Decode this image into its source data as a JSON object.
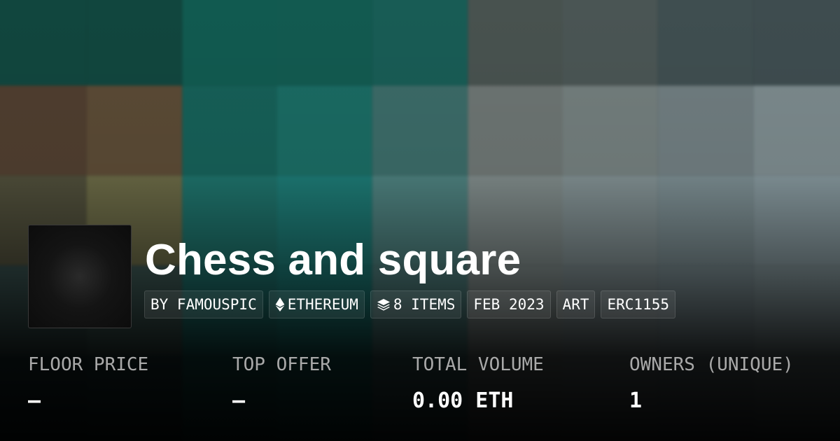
{
  "collection": {
    "title": "Chess and square"
  },
  "tags": [
    {
      "label": "BY FAMOUSPIC",
      "icon": ""
    },
    {
      "label": "ETHEREUM",
      "icon": "ethereum-icon"
    },
    {
      "label": "8 ITEMS",
      "icon": "layers-icon"
    },
    {
      "label": "FEB 2023",
      "icon": ""
    },
    {
      "label": "ART",
      "icon": ""
    },
    {
      "label": "ERC1155",
      "icon": ""
    }
  ],
  "stats": [
    {
      "label": "FLOOR PRICE",
      "value": "–"
    },
    {
      "label": "TOP OFFER",
      "value": "–"
    },
    {
      "label": "TOTAL VOLUME",
      "value": "0.00 ETH"
    },
    {
      "label": "OWNERS (UNIQUE)",
      "value": "1"
    }
  ],
  "colors": {
    "text": "#ffffff",
    "muted": "#a9a9a9",
    "background": "#0b0d0d"
  }
}
